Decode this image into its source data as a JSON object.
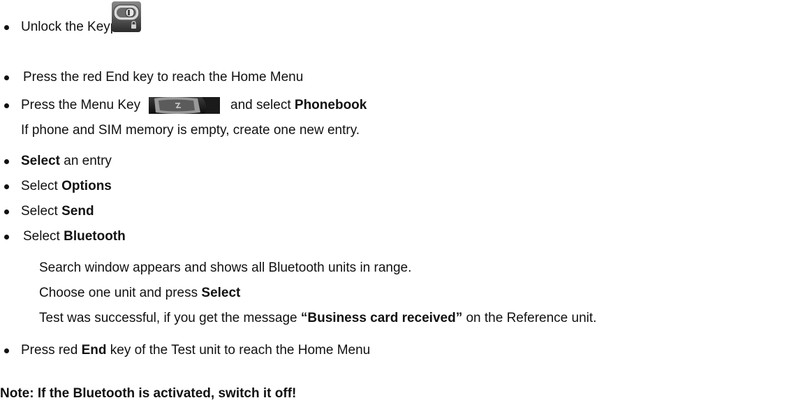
{
  "steps": {
    "s1": {
      "text": "Unlock the Keypad",
      "icon": "keypad-lock-slider-icon"
    },
    "s2": {
      "text": "Press the red End key to reach the Home Menu"
    },
    "s3": {
      "pre": "Press the Menu Key",
      "mid": "and select ",
      "bold": "Phonebook",
      "icon": "menu-key-icon"
    },
    "s3_note": "If phone and SIM memory is empty, create one new entry.",
    "s4": {
      "bold": "Select",
      "rest": " an entry"
    },
    "s5": {
      "pre": "Select ",
      "bold": "Options"
    },
    "s6": {
      "pre": "Select ",
      "bold": "Send"
    },
    "s7": {
      "pre": "Select ",
      "bold": "Bluetooth"
    },
    "s7_line1": "Search window appears and shows all Bluetooth units in range.",
    "s7_line2": {
      "pre": "Choose one unit and press ",
      "bold": "Select"
    },
    "s7_line3": {
      "pre": "Test was successful, if you get the message ",
      "bold": "“Business card received”",
      "post": " on the Reference unit."
    },
    "s8": {
      "pre": "Press red ",
      "bold": "End",
      "post": " key of the Test unit to reach the Home Menu"
    }
  },
  "note": "Note: If the Bluetooth is activated, switch it off!"
}
